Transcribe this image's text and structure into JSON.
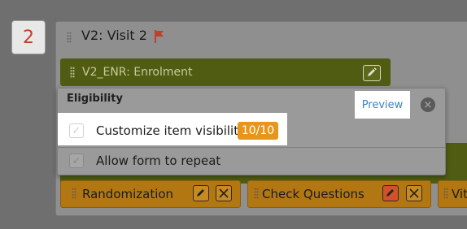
{
  "row_number": "2",
  "event": {
    "title": "V2: Visit 2"
  },
  "form": {
    "title": "V2_ENR: Enrolment"
  },
  "menu": {
    "title": "Eligibility",
    "preview_label": "Preview",
    "close_glyph": "×",
    "options": [
      {
        "label": "Customize item visibility",
        "badge": "10/10",
        "checked": true
      },
      {
        "label": "Allow form to repeat",
        "checked": false
      }
    ]
  },
  "tiles": [
    {
      "label": "Randomization"
    },
    {
      "label": "Check Questions"
    },
    {
      "label": "Vit"
    }
  ],
  "colors": {
    "accent_orange": "#e8961b",
    "preview_blue": "#3a85c6",
    "number_red": "#c0402a",
    "olive": "#4f5c12"
  },
  "icons": [
    "drag-handle-icon",
    "flag-icon",
    "edit-pencil-icon",
    "close-icon",
    "checkmark-icon",
    "remove-x-icon"
  ]
}
